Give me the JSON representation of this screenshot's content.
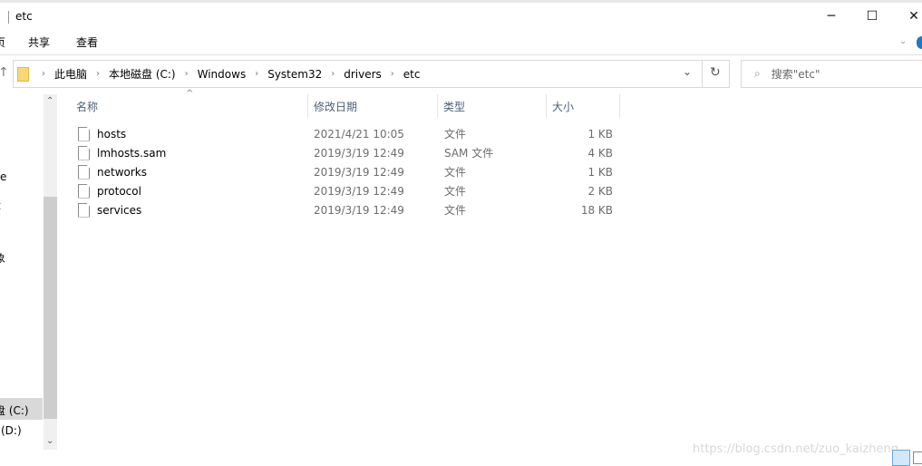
{
  "window": {
    "title": "etc",
    "minimize": "─",
    "maximize": "☐",
    "close": "✕"
  },
  "ribbon": {
    "tabs": [
      "页",
      "共享",
      "查看"
    ]
  },
  "address": {
    "crumbs": [
      "此电脑",
      "本地磁盘 (C:)",
      "Windows",
      "System32",
      "drivers",
      "etc"
    ],
    "refresh": "↻",
    "dropdown": "⌄"
  },
  "search": {
    "placeholder": "搜索\"etc\"",
    "icon": "search-icon"
  },
  "sidebar": {
    "fragments": [
      "e",
      "t",
      "象"
    ],
    "drives": [
      "盘 (C:)",
      "(D:)"
    ]
  },
  "columns": [
    "名称",
    "修改日期",
    "类型",
    "大小"
  ],
  "files": [
    {
      "name": "hosts",
      "date": "2021/4/21 10:05",
      "type": "文件",
      "size": "1 KB"
    },
    {
      "name": "lmhosts.sam",
      "date": "2019/3/19 12:49",
      "type": "SAM 文件",
      "size": "4 KB"
    },
    {
      "name": "networks",
      "date": "2019/3/19 12:49",
      "type": "文件",
      "size": "1 KB"
    },
    {
      "name": "protocol",
      "date": "2019/3/19 12:49",
      "type": "文件",
      "size": "2 KB"
    },
    {
      "name": "services",
      "date": "2019/3/19 12:49",
      "type": "文件",
      "size": "18 KB"
    }
  ],
  "watermark": "https://blog.csdn.net/zuo_kaizheng"
}
